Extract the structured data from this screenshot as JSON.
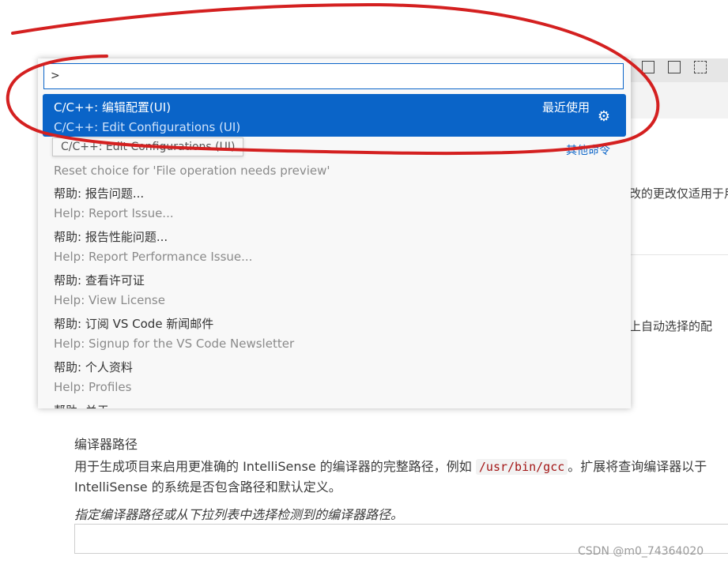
{
  "palette": {
    "input_value": ">",
    "selected": {
      "label": "C/C++: 编辑配置(UI)",
      "detail": "C/C++: Edit Configurations (UI)",
      "badge": "最近使用"
    },
    "tooltip": "C/C++: Edit Configurations (UI)",
    "other_commands": "其他命令",
    "items": [
      "Reset choice for 'File operation needs preview'",
      "帮助: 报告问题...",
      "Help: Report Issue...",
      "帮助: 报告性能问题...",
      "Help: Report Performance Issue...",
      "帮助: 查看许可证",
      "Help: View License",
      "帮助: 订阅 VS Code 新闻邮件",
      "Help: Signup for the VS Code Newsletter",
      "帮助: 个人资料",
      "Help: Profiles",
      "帮助: 关于"
    ],
    "item_styles": [
      "sub",
      "main",
      "sub",
      "main",
      "sub",
      "main",
      "sub",
      "main",
      "sub",
      "main",
      "sub",
      "main"
    ]
  },
  "background": {
    "fragment_1": "改的更改仅适用于用",
    "fragment_2": "上自动选择的配",
    "section_title": "编译器路径",
    "desc_before": "用于生成项目来启用更准确的 IntelliSense 的编译器的完整路径，例如 ",
    "desc_code": "/usr/bin/gcc",
    "desc_after": "。扩展将查询编译器以于 IntelliSense 的系统是否包含路径和默认定义。",
    "hint": "指定编译器路径或从下拉列表中选择检测到的编译器路径。",
    "input_value": ""
  },
  "watermark": "CSDN @m0_74364020",
  "icons": {
    "gear": "gear-icon",
    "layout": [
      "panel-layout-icon",
      "sidebar-layout-icon",
      "grid-layout-icon"
    ]
  },
  "colors": {
    "selection": "#0a64c8",
    "annotation": "#d42020",
    "link": "#0a64c8"
  }
}
